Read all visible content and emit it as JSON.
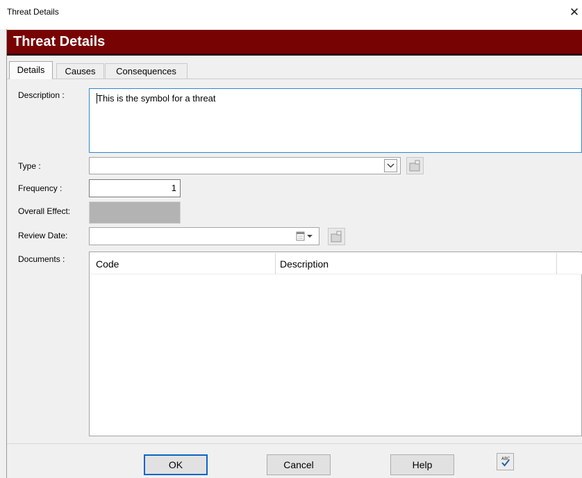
{
  "window": {
    "title": "Threat Details",
    "close_glyph": "✕"
  },
  "banner": {
    "title": "Threat Details",
    "color": "#780303"
  },
  "tabs": [
    {
      "label": "Details",
      "active": true
    },
    {
      "label": "Causes",
      "active": false
    },
    {
      "label": "Consequences",
      "active": false
    }
  ],
  "form": {
    "description": {
      "label": "Description :",
      "value": "This is the symbol for a threat"
    },
    "type": {
      "label": "Type :",
      "value": ""
    },
    "frequency": {
      "label": "Frequency :",
      "value": "1"
    },
    "overall_effect": {
      "label": "Overall Effect:",
      "value": ""
    },
    "review_date": {
      "label": "Review Date:",
      "value": ""
    },
    "documents": {
      "label": "Documents :",
      "columns": [
        "Code",
        "Description"
      ],
      "rows": []
    }
  },
  "buttons": {
    "ok": "OK",
    "cancel": "Cancel",
    "help": "Help"
  },
  "icons": {
    "combo_arrow": "chevron-down-icon",
    "lookup": "lookup-icon",
    "calendar": "calendar-icon",
    "spellcheck": "spellcheck-icon"
  }
}
